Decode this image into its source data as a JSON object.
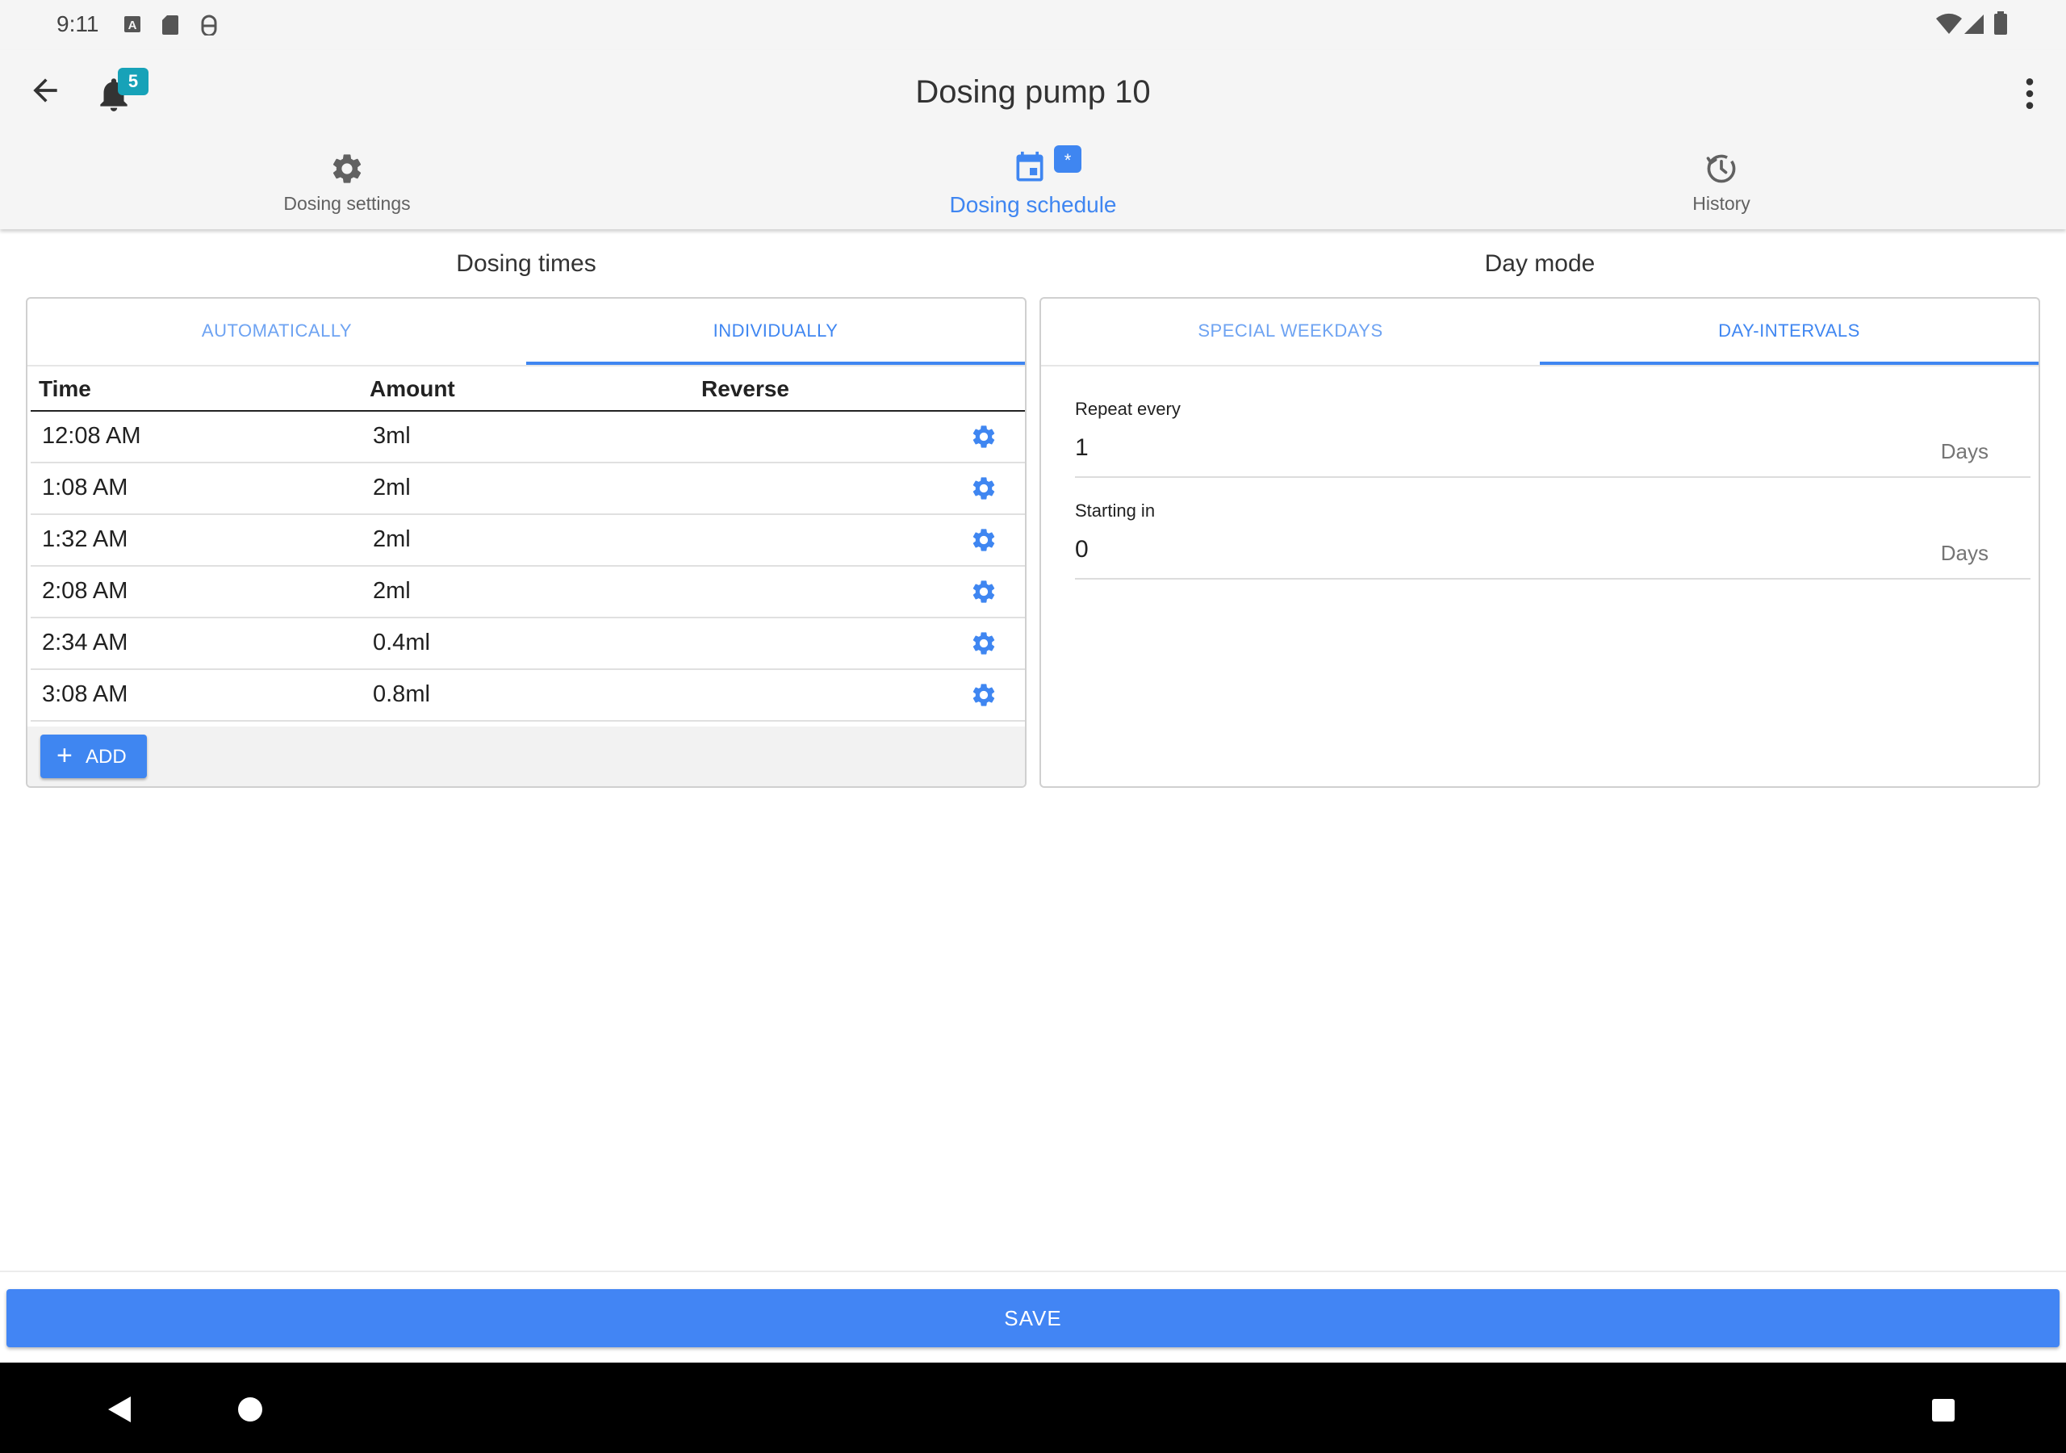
{
  "status_bar": {
    "time": "9:11"
  },
  "app_bar": {
    "title": "Dosing pump 10",
    "notification_count": "5"
  },
  "tabs": [
    {
      "label": "Dosing settings",
      "icon": "gear-icon",
      "active": false
    },
    {
      "label": "Dosing schedule",
      "icon": "calendar-icon",
      "active": true,
      "badge": "*"
    },
    {
      "label": "History",
      "icon": "history-icon",
      "active": false
    }
  ],
  "dosing_times": {
    "title": "Dosing times",
    "subtabs": [
      {
        "label": "AUTOMATICALLY",
        "active": false
      },
      {
        "label": "INDIVIDUALLY",
        "active": true
      }
    ],
    "columns": [
      "Time",
      "Amount",
      "Reverse"
    ],
    "rows": [
      {
        "time": "12:08 AM",
        "amount": "3ml"
      },
      {
        "time": "1:08 AM",
        "amount": "2ml"
      },
      {
        "time": "1:32 AM",
        "amount": "2ml"
      },
      {
        "time": "2:08 AM",
        "amount": "2ml"
      },
      {
        "time": "2:34 AM",
        "amount": "0.4ml"
      },
      {
        "time": "3:08 AM",
        "amount": "0.8ml"
      }
    ],
    "add_label": "ADD"
  },
  "day_mode": {
    "title": "Day mode",
    "subtabs": [
      {
        "label": "SPECIAL WEEKDAYS",
        "active": false
      },
      {
        "label": "DAY-INTERVALS",
        "active": true
      }
    ],
    "repeat_every": {
      "label": "Repeat every",
      "value": "1",
      "unit": "Days"
    },
    "starting_in": {
      "label": "Starting in",
      "value": "0",
      "unit": "Days"
    }
  },
  "save_label": "SAVE",
  "colors": {
    "accent": "#3f86f1",
    "save": "#4285f4",
    "badge": "#17a2b8"
  }
}
